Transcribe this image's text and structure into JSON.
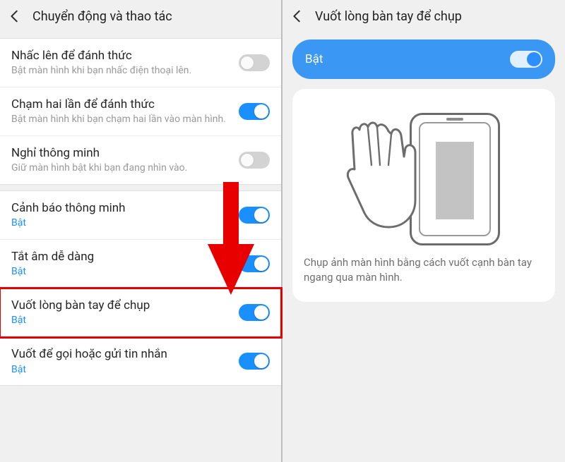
{
  "left": {
    "title": "Chuyển động và thao tác",
    "group1": [
      {
        "title": "Nhấc lên để đánh thức",
        "sub": "Bật màn hình khi bạn nhấc điện thoại lên.",
        "on": false
      },
      {
        "title": "Chạm hai lần để đánh thức",
        "sub": "Bật màn hình khi bạn chạm hai lần vào màn hình.",
        "on": true
      },
      {
        "title": "Nghỉ thông minh",
        "sub": "Giữ màn hình bật khi bạn đang nhìn vào.",
        "on": false
      }
    ],
    "group2": [
      {
        "title": "Cảnh báo thông minh",
        "sub": "Bật",
        "on": true
      },
      {
        "title": "Tắt âm dễ dàng",
        "sub": "Bật",
        "on": true
      },
      {
        "title": "Vuốt lòng bàn tay để chụp",
        "sub": "Bật",
        "on": true,
        "highlight": true
      },
      {
        "title": "Vuốt để gọi hoặc gửi tin nhắn",
        "sub": "Bật",
        "on": true
      }
    ]
  },
  "right": {
    "title": "Vuốt lòng bàn tay để chụp",
    "master_label": "Bật",
    "desc": "Chụp ảnh màn hình bằng cách vuốt cạnh bàn tay ngang qua màn hình."
  }
}
